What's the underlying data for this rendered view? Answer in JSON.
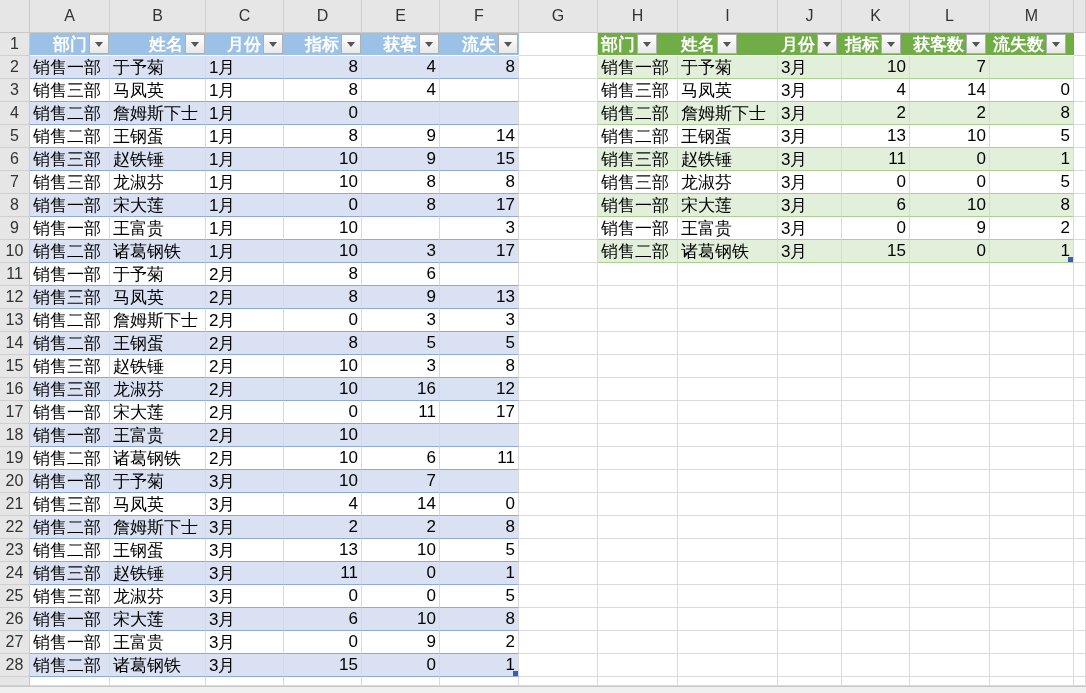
{
  "column_letters": [
    "A",
    "B",
    "C",
    "D",
    "E",
    "F",
    "G",
    "H",
    "I",
    "J",
    "K",
    "L",
    "M"
  ],
  "row_numbers": [
    "1",
    "2",
    "3",
    "4",
    "5",
    "6",
    "7",
    "8",
    "9",
    "10",
    "11",
    "12",
    "13",
    "14",
    "15",
    "16",
    "17",
    "18",
    "19",
    "20",
    "21",
    "22",
    "23",
    "24",
    "25",
    "26",
    "27",
    "28"
  ],
  "tables": [
    {
      "kind": "blue",
      "columns": [
        {
          "label": "部门"
        },
        {
          "label": "姓名"
        },
        {
          "label": "月份"
        },
        {
          "label": "指标"
        },
        {
          "label": "获客"
        },
        {
          "label": "流失"
        }
      ],
      "rows": [
        [
          "销售一部",
          "于予菊",
          "1月",
          "8",
          "4",
          "8"
        ],
        [
          "销售三部",
          "马凤英",
          "1月",
          "8",
          "4",
          null
        ],
        [
          "销售二部",
          "詹姆斯下士",
          "1月",
          "0",
          null,
          null
        ],
        [
          "销售二部",
          "王钢蛋",
          "1月",
          "8",
          "9",
          "14"
        ],
        [
          "销售三部",
          "赵铁锤",
          "1月",
          "10",
          "9",
          "15"
        ],
        [
          "销售三部",
          "龙淑芬",
          "1月",
          "10",
          "8",
          "8"
        ],
        [
          "销售一部",
          "宋大莲",
          "1月",
          "0",
          "8",
          "17"
        ],
        [
          "销售一部",
          "王富贵",
          "1月",
          "10",
          null,
          "3"
        ],
        [
          "销售二部",
          "诸葛钢铁",
          "1月",
          "10",
          "3",
          "17"
        ],
        [
          "销售一部",
          "于予菊",
          "2月",
          "8",
          "6",
          null
        ],
        [
          "销售三部",
          "马凤英",
          "2月",
          "8",
          "9",
          "13"
        ],
        [
          "销售二部",
          "詹姆斯下士",
          "2月",
          "0",
          "3",
          "3"
        ],
        [
          "销售二部",
          "王钢蛋",
          "2月",
          "8",
          "5",
          "5"
        ],
        [
          "销售三部",
          "赵铁锤",
          "2月",
          "10",
          "3",
          "8"
        ],
        [
          "销售三部",
          "龙淑芬",
          "2月",
          "10",
          "16",
          "12"
        ],
        [
          "销售一部",
          "宋大莲",
          "2月",
          "0",
          "11",
          "17"
        ],
        [
          "销售一部",
          "王富贵",
          "2月",
          "10",
          null,
          null
        ],
        [
          "销售二部",
          "诸葛钢铁",
          "2月",
          "10",
          "6",
          "11"
        ],
        [
          "销售一部",
          "于予菊",
          "3月",
          "10",
          "7",
          null
        ],
        [
          "销售三部",
          "马凤英",
          "3月",
          "4",
          "14",
          "0"
        ],
        [
          "销售二部",
          "詹姆斯下士",
          "3月",
          "2",
          "2",
          "8"
        ],
        [
          "销售二部",
          "王钢蛋",
          "3月",
          "13",
          "10",
          "5"
        ],
        [
          "销售三部",
          "赵铁锤",
          "3月",
          "11",
          "0",
          "1"
        ],
        [
          "销售三部",
          "龙淑芬",
          "3月",
          "0",
          "0",
          "5"
        ],
        [
          "销售一部",
          "宋大莲",
          "3月",
          "6",
          "10",
          "8"
        ],
        [
          "销售一部",
          "王富贵",
          "3月",
          "0",
          "9",
          "2"
        ],
        [
          "销售二部",
          "诸葛钢铁",
          "3月",
          "15",
          "0",
          "1"
        ]
      ]
    },
    {
      "kind": "green",
      "columns": [
        {
          "label": "部门"
        },
        {
          "label": "姓名"
        },
        {
          "label": "月份"
        },
        {
          "label": "指标"
        },
        {
          "label": "获客数"
        },
        {
          "label": "流失数"
        }
      ],
      "rows": [
        [
          "销售一部",
          "于予菊",
          "3月",
          "10",
          "7",
          null
        ],
        [
          "销售三部",
          "马凤英",
          "3月",
          "4",
          "14",
          "0"
        ],
        [
          "销售二部",
          "詹姆斯下士",
          "3月",
          "2",
          "2",
          "8"
        ],
        [
          "销售二部",
          "王钢蛋",
          "3月",
          "13",
          "10",
          "5"
        ],
        [
          "销售三部",
          "赵铁锤",
          "3月",
          "11",
          "0",
          "1"
        ],
        [
          "销售三部",
          "龙淑芬",
          "3月",
          "0",
          "0",
          "5"
        ],
        [
          "销售一部",
          "宋大莲",
          "3月",
          "6",
          "10",
          "8"
        ],
        [
          "销售一部",
          "王富贵",
          "3月",
          "0",
          "9",
          "2"
        ],
        [
          "销售二部",
          "诸葛钢铁",
          "3月",
          "15",
          "0",
          "1"
        ]
      ]
    }
  ]
}
